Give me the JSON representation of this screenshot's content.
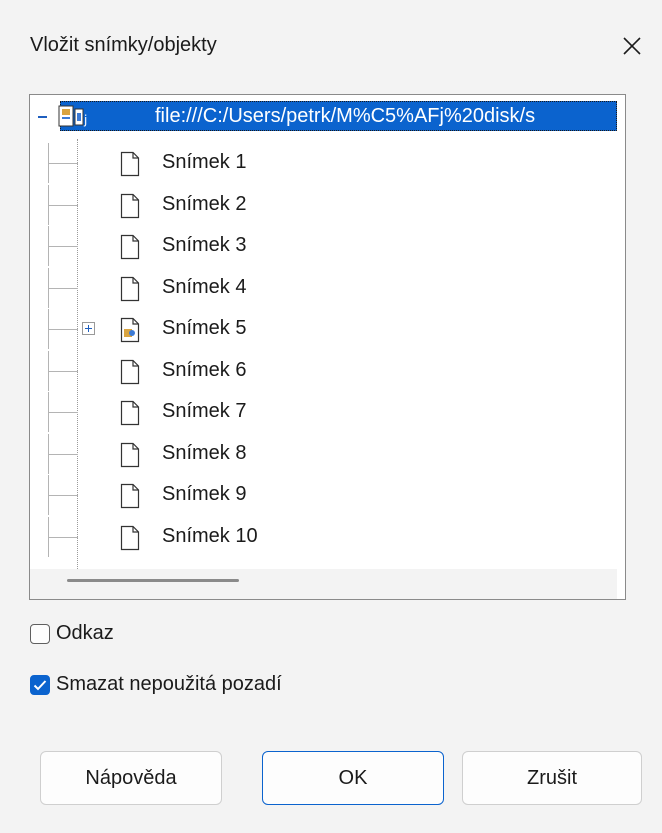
{
  "dialog": {
    "title": "Vložit snímky/objekty",
    "close_icon": "close-icon"
  },
  "tree": {
    "root": {
      "label": "file:///C:/Users/petrk/M%C5%AFj%20disk/s",
      "icon": "presentation-icon",
      "expanded": true
    },
    "items": [
      {
        "label": "Snímek 1",
        "icon": "slide-icon",
        "has_children": false
      },
      {
        "label": "Snímek 2",
        "icon": "slide-icon",
        "has_children": false
      },
      {
        "label": "Snímek 3",
        "icon": "slide-icon",
        "has_children": false
      },
      {
        "label": "Snímek 4",
        "icon": "slide-icon",
        "has_children": false
      },
      {
        "label": "Snímek 5",
        "icon": "slide-with-objects-icon",
        "has_children": true
      },
      {
        "label": "Snímek 6",
        "icon": "slide-icon",
        "has_children": false
      },
      {
        "label": "Snímek 7",
        "icon": "slide-icon",
        "has_children": false
      },
      {
        "label": "Snímek 8",
        "icon": "slide-icon",
        "has_children": false
      },
      {
        "label": "Snímek 9",
        "icon": "slide-icon",
        "has_children": false
      },
      {
        "label": "Snímek 10",
        "icon": "slide-icon",
        "has_children": false
      }
    ]
  },
  "options": {
    "link": {
      "label": "Odkaz",
      "checked": false
    },
    "delete_unused_backgrounds": {
      "label": "Smazat nepoužitá pozadí",
      "checked": true
    }
  },
  "buttons": {
    "help": "Nápověda",
    "ok": "OK",
    "cancel": "Zrušit"
  },
  "colors": {
    "accent": "#0b63ce",
    "background": "#f3f3f3"
  }
}
